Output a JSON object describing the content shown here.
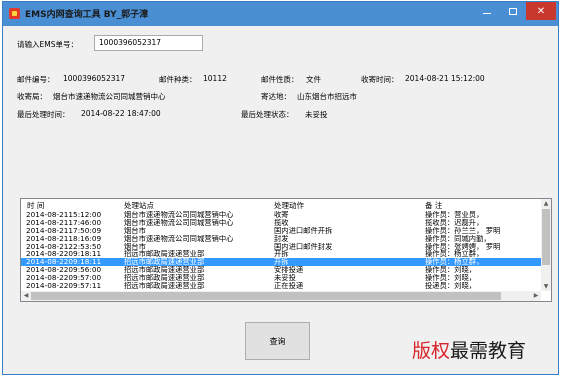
{
  "window": {
    "title": "EMS内网查询工具 BY_郭子漳"
  },
  "query": {
    "label": "请输入EMS单号：",
    "value": "1000396052317"
  },
  "info": {
    "mail_no_label": "邮件编号：",
    "mail_no": "1000396052317",
    "mail_type_label": "邮件种类：",
    "mail_type": "10112",
    "mail_nature_label": "邮件性质：",
    "mail_nature": "文件",
    "receive_time_label": "收寄时间：",
    "receive_time": "2014-08-21 15:12:00",
    "origin_label": "收寄局：",
    "origin": "烟台市速递物流公司同城营销中心",
    "dest_label": "寄达地：",
    "dest": "山东烟台市招远市",
    "last_time_label": "最后处理时间：",
    "last_time": "2014-08-22 18:47:00",
    "last_status_label": "最后处理状态：",
    "last_status": "未妥投"
  },
  "table": {
    "headers": [
      "时 间",
      "处理站点",
      "处理动作",
      "备 注"
    ],
    "selected_index": 6,
    "rows": [
      [
        "2014-08-2115:12:00",
        "烟台市速递物流公司同城营销中心",
        "收寄",
        "操作员：营业员，"
      ],
      [
        "2014-08-2117:46:00",
        "烟台市速递物流公司同城营销中心",
        "揽收",
        "揽收员：迟磊升，"
      ],
      [
        "2014-08-2117:50:09",
        "烟台市",
        "国内进口邮件开拆",
        "操作员：孙兰兰， 罗明"
      ],
      [
        "2014-08-2118:16:09",
        "烟台市速递物流公司同城营销中心",
        "封发",
        "操作员：同城内勤，"
      ],
      [
        "2014-08-2122:53:50",
        "烟台市",
        "国内进口邮件封发",
        "操作员：张娉娉， 罗明"
      ],
      [
        "2014-08-2209:18:11",
        "招远市邮政局速递营业部",
        "开拆",
        "操作员：杨立群，"
      ],
      [
        "2014-08-2209:18:11",
        "招远市邮政局速递营业部",
        "开拆",
        "操作员：杨立群，"
      ],
      [
        "2014-08-2209:56:00",
        "招远市邮政局速递营业部",
        "安排投递",
        "操作员：刘晓，"
      ],
      [
        "2014-08-2209:57:00",
        "招远市邮政局速递营业部",
        "未妥投",
        "操作员：刘晓，"
      ],
      [
        "2014-08-2209:57:11",
        "招远市邮政局速递营业部",
        "正在投递",
        "投递员：刘晓，"
      ]
    ]
  },
  "button": {
    "query_label": "查询"
  },
  "watermark": {
    "part1": "版权",
    "part2": "最需教育"
  },
  "colors": {
    "titlebar": "#4a8fd4",
    "selection": "#3399ff",
    "close": "#c9382c",
    "watermark_red": "#d8232a"
  }
}
